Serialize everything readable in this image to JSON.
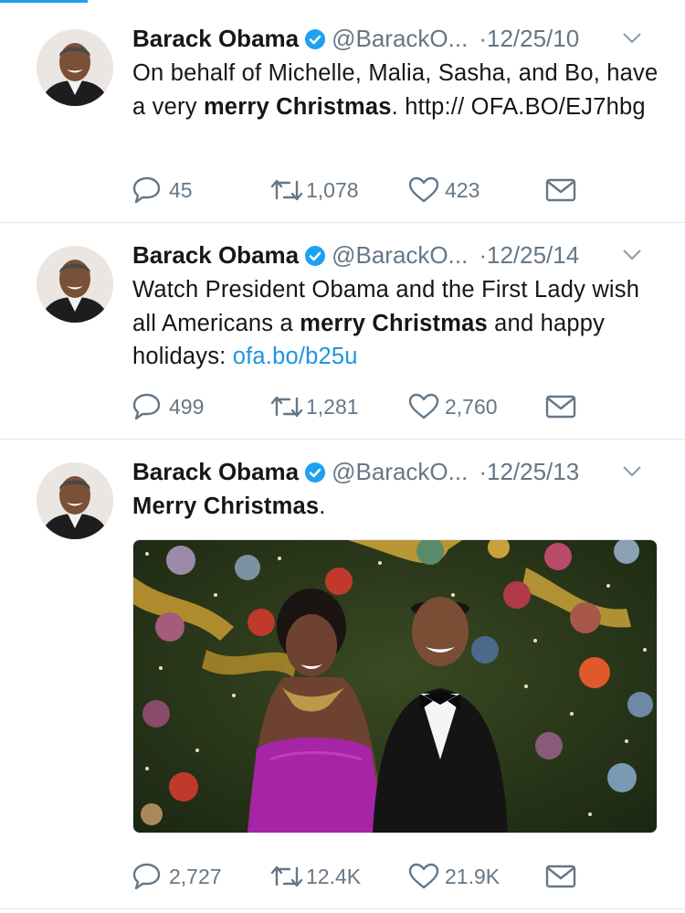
{
  "tweets": [
    {
      "name": "Barack Obama",
      "handle": "@BarackO...",
      "date": "·12/25/10",
      "text": [
        {
          "t": "On behalf of Michelle, Malia, Sasha, and Bo, have a very "
        },
        {
          "t": "merry Christmas",
          "bold": true
        },
        {
          "t": ". http:// OFA.BO/EJ7hbg"
        }
      ],
      "replies": "45",
      "retweets": "1,078",
      "likes": "423"
    },
    {
      "name": "Barack Obama",
      "handle": "@BarackO...",
      "date": "·12/25/14",
      "text": [
        {
          "t": "Watch President Obama and the First Lady wish all Americans a "
        },
        {
          "t": "merry Christmas",
          "bold": true
        },
        {
          "t": " and happy holidays: "
        },
        {
          "t": "ofa.bo/b25u",
          "link": true
        }
      ],
      "replies": "499",
      "retweets": "1,281",
      "likes": "2,760"
    },
    {
      "name": "Barack Obama",
      "handle": "@BarackO...",
      "date": "·12/25/13",
      "text": [
        {
          "t": "Merry Christmas",
          "bold": true
        },
        {
          "t": "."
        }
      ],
      "replies": "2,727",
      "retweets": "12.4K",
      "likes": "21.9K"
    }
  ],
  "colors": {
    "accent": "#1da1f2",
    "link": "#1b95e0",
    "muted": "#657786",
    "divider": "#e1e8ed",
    "verified": "#1da1f2"
  },
  "icons": [
    "reply-icon",
    "retweet-icon",
    "like-icon",
    "direct-message-icon",
    "verified-badge-icon",
    "chevron-down-icon"
  ]
}
